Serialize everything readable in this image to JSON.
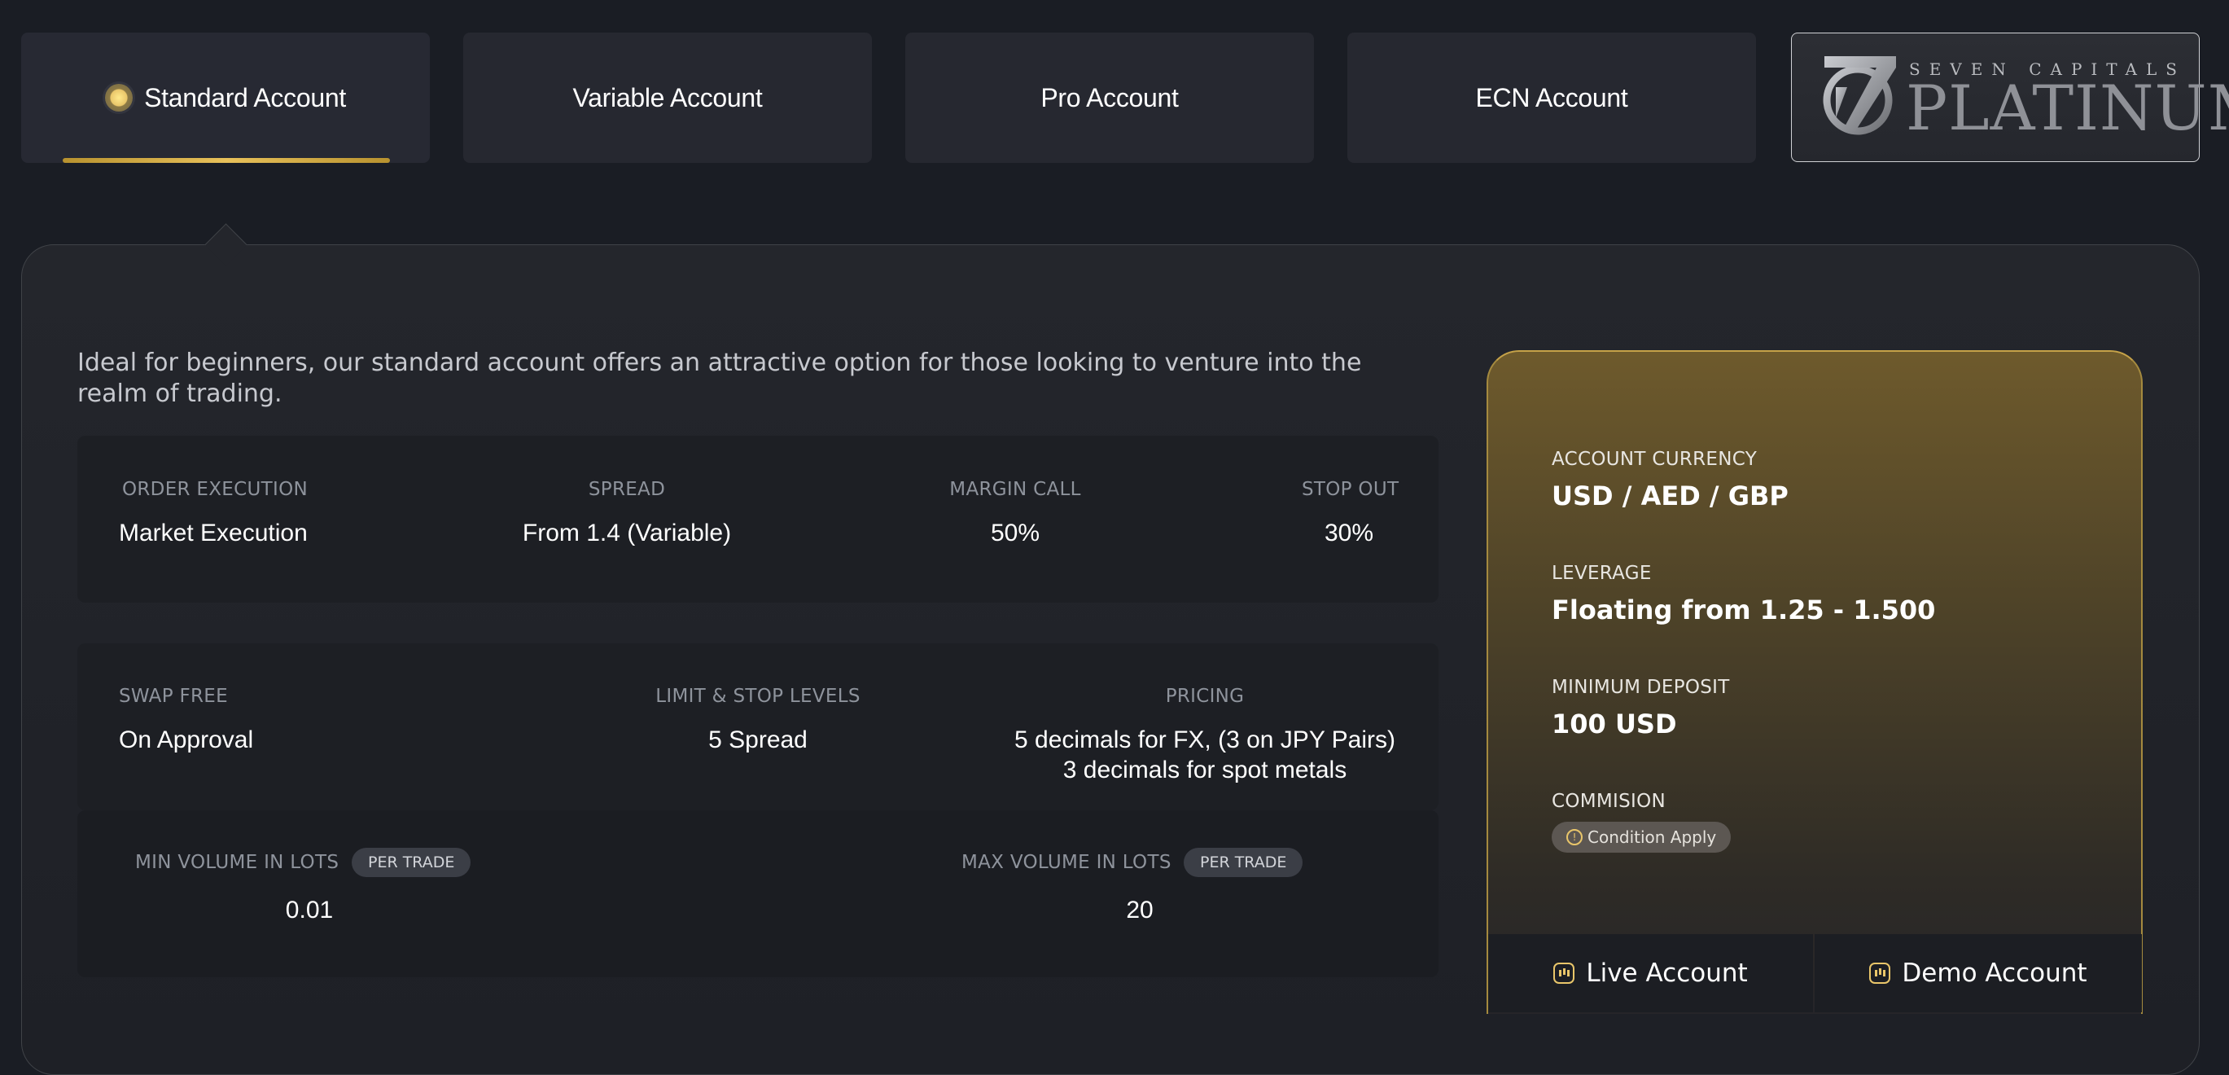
{
  "tabs": [
    {
      "label": "Standard Account",
      "active": true
    },
    {
      "label": "Variable Account",
      "active": false
    },
    {
      "label": "Pro Account",
      "active": false
    },
    {
      "label": "ECN Account",
      "active": false
    }
  ],
  "logo": {
    "top": "SEVEN CAPITALS",
    "main": "PLATINUM"
  },
  "description": "Ideal for beginners, our standard account offers an attractive option for those looking to venture into the realm of trading.",
  "specs_row1": [
    {
      "label": "ORDER EXECUTION",
      "value": "Market Execution"
    },
    {
      "label": "SPREAD",
      "value": "From 1.4 (Variable)"
    },
    {
      "label": "MARGIN CALL",
      "value": "50%"
    },
    {
      "label": "STOP OUT",
      "value": "30%"
    }
  ],
  "specs_row2": [
    {
      "label": "SWAP FREE",
      "value": "On Approval"
    },
    {
      "label": "LIMIT & STOP LEVELS",
      "value": "5 Spread"
    },
    {
      "label": "PRICING",
      "value_line1": "5 decimals for FX, (3 on JPY Pairs)",
      "value_line2": "3 decimals for spot metals"
    }
  ],
  "volume": {
    "min_label": "MIN VOLUME IN LOTS",
    "min_badge": "PER TRADE",
    "min_value": "0.01",
    "max_label": "MAX VOLUME IN LOTS",
    "max_badge": "PER TRADE",
    "max_value": "20"
  },
  "card": {
    "currency_label": "ACCOUNT CURRENCY",
    "currency_value": "USD / AED / GBP",
    "leverage_label": "LEVERAGE",
    "leverage_value": "Floating from 1.25 - 1.500",
    "deposit_label": "MINIMUM DEPOSIT",
    "deposit_value": "100 USD",
    "commission_label": "COMMISION",
    "commission_badge": "Condition Apply",
    "live_button": "Live Account",
    "demo_button": "Demo Account"
  },
  "colors": {
    "accent": "#e9c66a",
    "background": "#1a1d24"
  }
}
